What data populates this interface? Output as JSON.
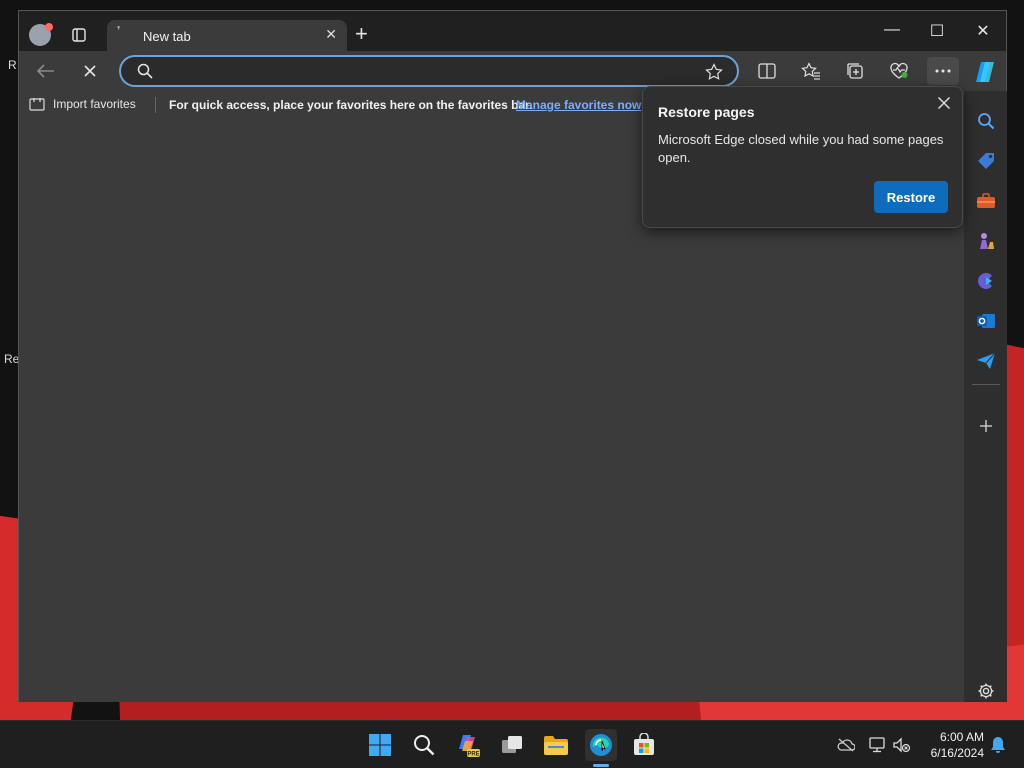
{
  "browser": {
    "tab": {
      "title": "New tab"
    },
    "address": {
      "value": ""
    },
    "favorites_bar": {
      "import_label": "Import favorites",
      "message": "For quick access, place your favorites here on the favorites bar.",
      "manage_link": "Manage favorites now"
    }
  },
  "restore_popup": {
    "title": "Restore pages",
    "body": "Microsoft Edge closed while you had some pages open.",
    "button_label": "Restore"
  },
  "desktop": {
    "fragments": [
      "R",
      "Re"
    ]
  },
  "taskbar": {
    "time": "6:00 AM",
    "date": "6/16/2024"
  },
  "colors": {
    "accent": "#0f6cbd",
    "link": "#7aaeff",
    "address_focus": "#6aa3d8"
  }
}
